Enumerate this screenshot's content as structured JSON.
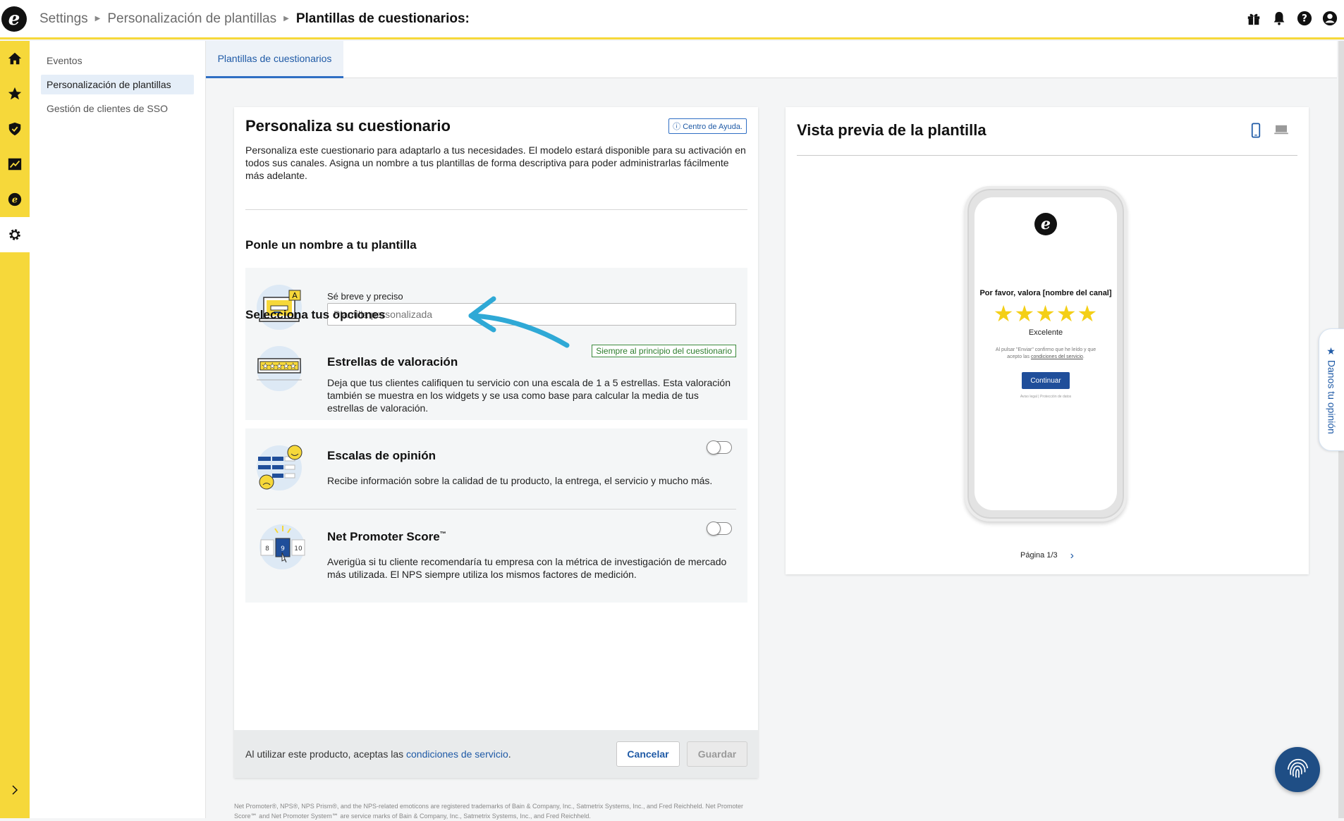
{
  "header": {
    "breadcrumbs": [
      "Settings",
      "Personalización de plantillas"
    ],
    "current": "Plantillas de cuestionarios:",
    "logo_letter": "e"
  },
  "sidebar": {
    "items": [
      {
        "label": "Eventos",
        "selected": false
      },
      {
        "label": "Personalización de plantillas",
        "selected": true
      },
      {
        "label": "Gestión de clientes de SSO",
        "selected": false
      }
    ]
  },
  "tabs": [
    {
      "label": "Plantillas de cuestionarios",
      "active": true
    }
  ],
  "form": {
    "title": "Personaliza su cuestionario",
    "help_label": "Centro de Ayuda.",
    "intro": "Personaliza este cuestionario para adaptarlo a tus necesidades. El modelo estará disponible para su activación en todos sus canales. Asigna un nombre a tus plantillas de forma descriptiva para poder administrarlas fácilmente más adelante.",
    "name_section": "Ponle un nombre a tu plantilla",
    "name_label": "Sé breve y preciso",
    "name_placeholder": "Plantilla personalizada",
    "options_section": "Selecciona tus opciones",
    "options": [
      {
        "title": "Estrellas de valoración",
        "badge": "Siempre al principio del cuestionario",
        "desc": "Deja que tus clientes califiquen tu servicio con una escala de 1 a 5 estrellas. Esta valoración también se muestra en los widgets y se usa como base para calcular la media de tus estrellas de valoración."
      },
      {
        "title": "Escalas de opinión",
        "enabled": false,
        "desc": "Recibe información sobre la calidad de tu producto, la entrega, el servicio y mucho más."
      },
      {
        "title": "Net Promoter Score",
        "tm": "™",
        "enabled": false,
        "desc": "Averigüa si tu cliente recomendaría tu empresa con la métrica de investigación de mercado más utilizada. El NPS siempre utiliza los mismos factores de medición."
      }
    ],
    "nps_numbers": [
      "8",
      "9",
      "10"
    ],
    "footer_text": "Al utilizar este producto, aceptas las ",
    "footer_link": "condiciones de servicio",
    "footer_end": ".",
    "cancel": "Cancelar",
    "save": "Guardar"
  },
  "legal": "Net Promoter®, NPS®, NPS Prism®, and the NPS-related emoticons are registered trademarks of Bain & Company, Inc., Satmetrix Systems, Inc., and Fred Reichheld. Net Promoter Score℠ and Net Promoter System℠ are service marks of Bain & Company, Inc., Satmetrix Systems, Inc., and Fred Reichheld.",
  "preview": {
    "title": "Vista previa de la plantilla",
    "question": "Por favor, valora [nombre del canal]",
    "stars": "★★★★★",
    "rating_label": "Excelente",
    "terms": "Al pulsar \"Enviar\" confirmo que he leído y que acepto las ",
    "terms_link": "condiciones del servicio",
    "terms_end": ".",
    "button": "Continuar",
    "links": "Aviso legal | Protección de datos",
    "pager": "Página 1/3"
  },
  "feedback_tab": "Danos tu opinión",
  "colors": {
    "accent": "#f6d83a",
    "link": "#1f5aa6",
    "star": "#f4cf17",
    "button": "#1f4e9a"
  }
}
